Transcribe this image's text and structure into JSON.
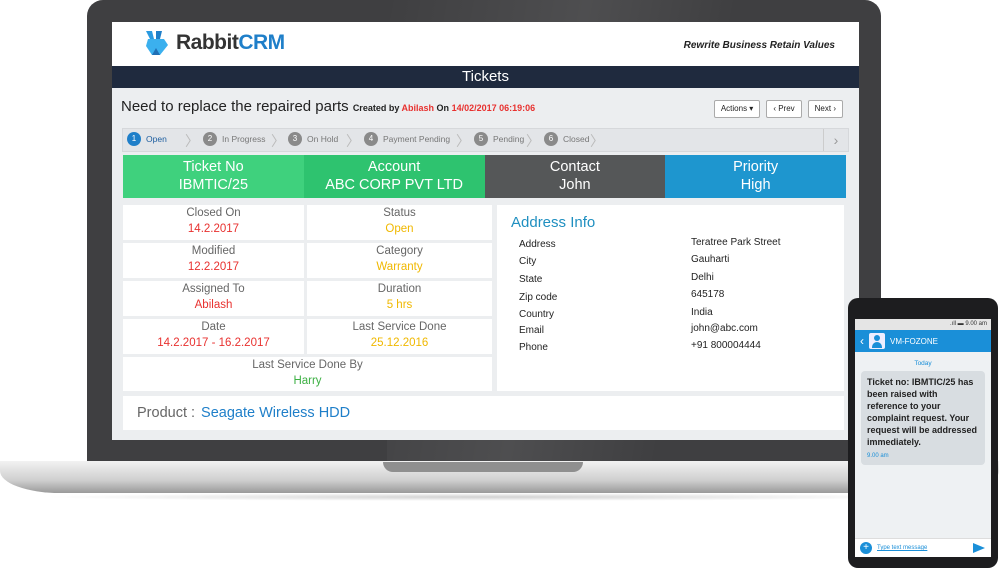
{
  "header": {
    "logo_text_1": "Rabbit",
    "logo_text_2": "CRM",
    "tagline": "Rewrite Business Retain Values",
    "title": "Tickets"
  },
  "ticket": {
    "subject": "Need to replace the repaired parts",
    "created_by_label": "Created by",
    "created_by": "Abilash",
    "on_label": "On",
    "created_on": "14/02/2017 06:19:06"
  },
  "buttons": {
    "actions": "Actions ▾",
    "prev": "‹ Prev",
    "next": "Next ›"
  },
  "steps": [
    {
      "num": "1",
      "label": "Open"
    },
    {
      "num": "2",
      "label": "In Progress"
    },
    {
      "num": "3",
      "label": "On Hold"
    },
    {
      "num": "4",
      "label": "Payment Pending"
    },
    {
      "num": "5",
      "label": "Pending"
    },
    {
      "num": "6",
      "label": "Closed"
    }
  ],
  "tiles": {
    "ticket_no_label": "Ticket No",
    "ticket_no": "IBMTIC/25",
    "account_label": "Account",
    "account": "ABC CORP PVT LTD",
    "contact_label": "Contact",
    "contact": "John",
    "priority_label": "Priority",
    "priority": "High"
  },
  "details": {
    "closed_on_label": "Closed On",
    "closed_on": "14.2.2017",
    "status_label": "Status",
    "status": "Open",
    "modified_label": "Modified",
    "modified": "12.2.2017",
    "category_label": "Category",
    "category": "Warranty",
    "assigned_label": "Assigned To",
    "assigned": "Abilash",
    "duration_label": "Duration",
    "duration": "5 hrs",
    "date_label": "Date",
    "date": "14.2.2017 - 16.2.2017",
    "last_service_label": "Last Service Done",
    "last_service": "25.12.2016",
    "last_service_by_label": "Last Service Done By",
    "last_service_by": "Harry"
  },
  "address": {
    "title": "Address Info",
    "rows": [
      {
        "label": "Address",
        "value": "Teratree Park Street"
      },
      {
        "label": "City",
        "value": "Gauharti"
      },
      {
        "label": "State",
        "value": "Delhi"
      },
      {
        "label": "Zip code",
        "value": "645178"
      },
      {
        "label": "Country",
        "value": "India"
      },
      {
        "label": "Email",
        "value": "john@abc.com"
      },
      {
        "label": "Phone",
        "value": "+91 800004444"
      }
    ]
  },
  "product": {
    "label": "Product :",
    "value": "Seagate Wireless HDD"
  },
  "phone": {
    "status": ".ıll ▬ 9.00 am",
    "sender": "VM-FOZONE",
    "today": "Today",
    "message": "Ticket no: IBMTIC/25 has been raised with reference to your complaint request. Your request will be addressed immediately.",
    "time": "9.00 am",
    "input_placeholder": "Type text message"
  },
  "colors": {
    "accent": "#1f7fc9",
    "title_bar": "#1f2a3e",
    "tile_ticket": "#3fd17d",
    "tile_account": "#2ec36f",
    "tile_contact": "#555758",
    "tile_priority": "#1e96cf"
  }
}
